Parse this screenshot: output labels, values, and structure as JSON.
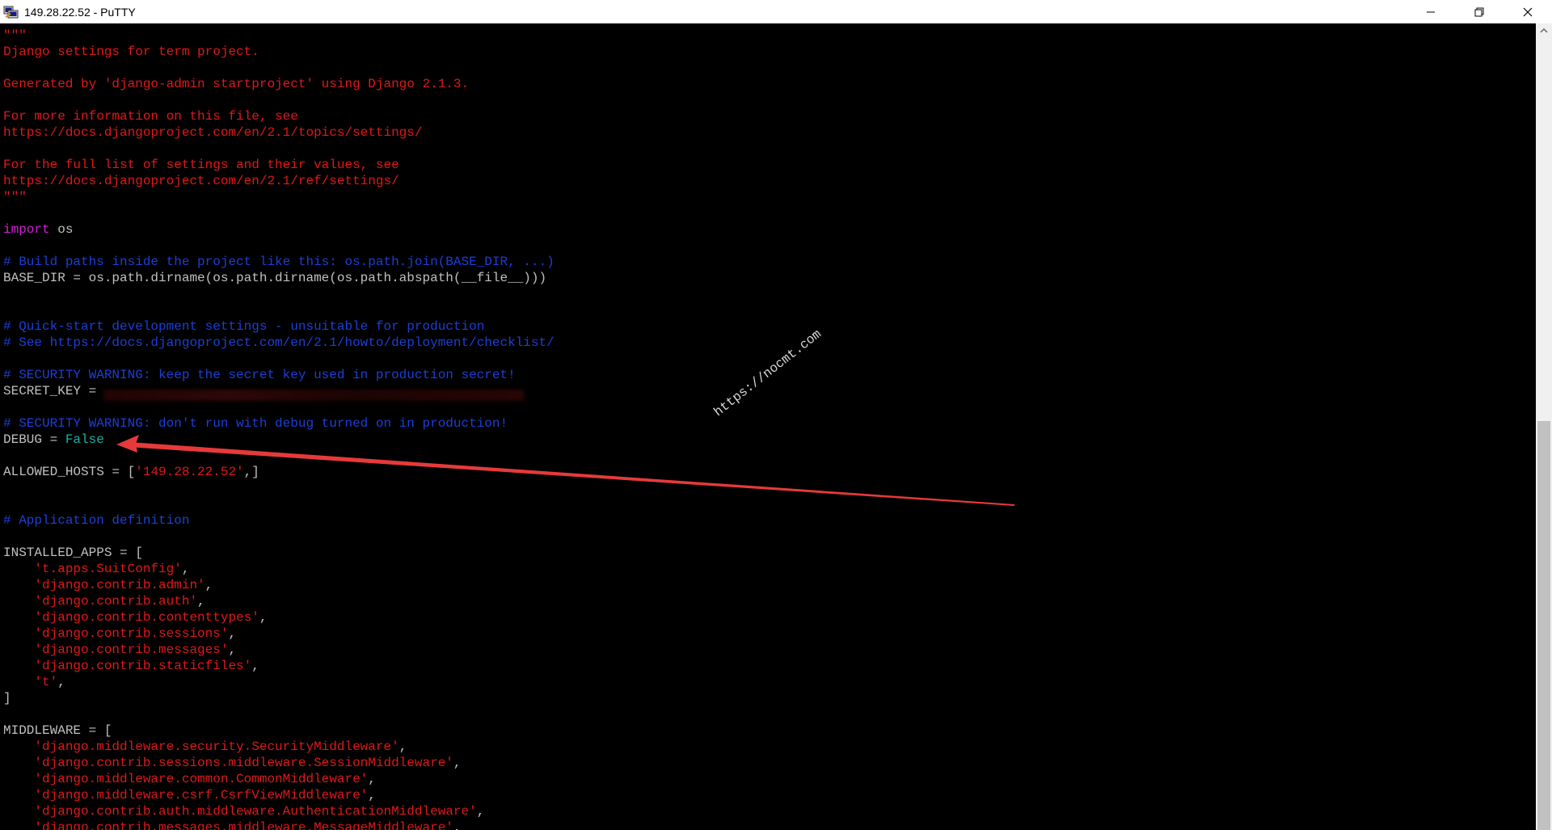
{
  "window": {
    "title": "149.28.22.52 - PuTTY",
    "app_icon": "putty-icon",
    "controls": [
      "minimize-icon",
      "restore-icon",
      "close-icon"
    ]
  },
  "terminal": {
    "lines": [
      {
        "segments": [
          {
            "text": "\"\"\"",
            "color": "red"
          }
        ]
      },
      {
        "segments": [
          {
            "text": "Django settings for term project.",
            "color": "red"
          }
        ]
      },
      {
        "segments": [
          {
            "text": "",
            "color": "gray"
          }
        ]
      },
      {
        "segments": [
          {
            "text": "Generated by 'django-admin startproject' using Django 2.1.3.",
            "color": "red"
          }
        ]
      },
      {
        "segments": [
          {
            "text": "",
            "color": "gray"
          }
        ]
      },
      {
        "segments": [
          {
            "text": "For more information on this file, see",
            "color": "red"
          }
        ]
      },
      {
        "segments": [
          {
            "text": "https://docs.djangoproject.com/en/2.1/topics/settings/",
            "color": "red"
          }
        ]
      },
      {
        "segments": [
          {
            "text": "",
            "color": "gray"
          }
        ]
      },
      {
        "segments": [
          {
            "text": "For the full list of settings and their values, see",
            "color": "red"
          }
        ]
      },
      {
        "segments": [
          {
            "text": "https://docs.djangoproject.com/en/2.1/ref/settings/",
            "color": "red"
          }
        ]
      },
      {
        "segments": [
          {
            "text": "\"\"\"",
            "color": "red"
          }
        ]
      },
      {
        "segments": [
          {
            "text": "",
            "color": "gray"
          }
        ]
      },
      {
        "segments": [
          {
            "text": "import",
            "color": "magenta"
          },
          {
            "text": " os",
            "color": "gray"
          }
        ]
      },
      {
        "segments": [
          {
            "text": "",
            "color": "gray"
          }
        ]
      },
      {
        "segments": [
          {
            "text": "# Build paths inside the project like this: os.path.join(BASE_DIR, ...)",
            "color": "blue"
          }
        ]
      },
      {
        "segments": [
          {
            "text": "BASE_DIR = os.path.dirname(os.path.dirname(os.path.abspath(__file__)))",
            "color": "gray"
          }
        ]
      },
      {
        "segments": [
          {
            "text": "",
            "color": "gray"
          }
        ]
      },
      {
        "segments": [
          {
            "text": "",
            "color": "gray"
          }
        ]
      },
      {
        "segments": [
          {
            "text": "# Quick-start development settings - unsuitable for production",
            "color": "blue"
          }
        ]
      },
      {
        "segments": [
          {
            "text": "# See https://docs.djangoproject.com/en/2.1/howto/deployment/checklist/",
            "color": "blue"
          }
        ]
      },
      {
        "segments": [
          {
            "text": "",
            "color": "gray"
          }
        ]
      },
      {
        "segments": [
          {
            "text": "# SECURITY WARNING: keep the secret key used in production secret!",
            "color": "blue"
          }
        ]
      },
      {
        "segments": [
          {
            "text": "SECRET_KEY = ",
            "color": "gray"
          }
        ]
      },
      {
        "segments": [
          {
            "text": "",
            "color": "gray"
          }
        ]
      },
      {
        "segments": [
          {
            "text": "# SECURITY WARNING: don't run with debug turned on in production!",
            "color": "blue"
          }
        ]
      },
      {
        "segments": [
          {
            "text": "DEBUG = ",
            "color": "gray"
          },
          {
            "text": "False",
            "color": "cyan"
          }
        ]
      },
      {
        "segments": [
          {
            "text": "",
            "color": "gray"
          }
        ]
      },
      {
        "segments": [
          {
            "text": "ALLOWED_HOSTS = [",
            "color": "gray"
          },
          {
            "text": "'149.28.22.52'",
            "color": "red"
          },
          {
            "text": ",]",
            "color": "gray"
          }
        ]
      },
      {
        "segments": [
          {
            "text": "",
            "color": "gray"
          }
        ]
      },
      {
        "segments": [
          {
            "text": "",
            "color": "gray"
          }
        ]
      },
      {
        "segments": [
          {
            "text": "# Application definition",
            "color": "blue"
          }
        ]
      },
      {
        "segments": [
          {
            "text": "",
            "color": "gray"
          }
        ]
      },
      {
        "segments": [
          {
            "text": "INSTALLED_APPS = [",
            "color": "gray"
          }
        ]
      },
      {
        "segments": [
          {
            "text": "    ",
            "color": "gray"
          },
          {
            "text": "'t.apps.SuitConfig'",
            "color": "red"
          },
          {
            "text": ",",
            "color": "gray"
          }
        ]
      },
      {
        "segments": [
          {
            "text": "    ",
            "color": "gray"
          },
          {
            "text": "'django.contrib.admin'",
            "color": "red"
          },
          {
            "text": ",",
            "color": "gray"
          }
        ]
      },
      {
        "segments": [
          {
            "text": "    ",
            "color": "gray"
          },
          {
            "text": "'django.contrib.auth'",
            "color": "red"
          },
          {
            "text": ",",
            "color": "gray"
          }
        ]
      },
      {
        "segments": [
          {
            "text": "    ",
            "color": "gray"
          },
          {
            "text": "'django.contrib.contenttypes'",
            "color": "red"
          },
          {
            "text": ",",
            "color": "gray"
          }
        ]
      },
      {
        "segments": [
          {
            "text": "    ",
            "color": "gray"
          },
          {
            "text": "'django.contrib.sessions'",
            "color": "red"
          },
          {
            "text": ",",
            "color": "gray"
          }
        ]
      },
      {
        "segments": [
          {
            "text": "    ",
            "color": "gray"
          },
          {
            "text": "'django.contrib.messages'",
            "color": "red"
          },
          {
            "text": ",",
            "color": "gray"
          }
        ]
      },
      {
        "segments": [
          {
            "text": "    ",
            "color": "gray"
          },
          {
            "text": "'django.contrib.staticfiles'",
            "color": "red"
          },
          {
            "text": ",",
            "color": "gray"
          }
        ]
      },
      {
        "segments": [
          {
            "text": "    ",
            "color": "gray"
          },
          {
            "text": "'t'",
            "color": "red"
          },
          {
            "text": ",",
            "color": "gray"
          }
        ]
      },
      {
        "segments": [
          {
            "text": "]",
            "color": "gray"
          }
        ]
      },
      {
        "segments": [
          {
            "text": "",
            "color": "gray"
          }
        ]
      },
      {
        "segments": [
          {
            "text": "MIDDLEWARE = [",
            "color": "gray"
          }
        ]
      },
      {
        "segments": [
          {
            "text": "    ",
            "color": "gray"
          },
          {
            "text": "'django.middleware.security.SecurityMiddleware'",
            "color": "red"
          },
          {
            "text": ",",
            "color": "gray"
          }
        ]
      },
      {
        "segments": [
          {
            "text": "    ",
            "color": "gray"
          },
          {
            "text": "'django.contrib.sessions.middleware.SessionMiddleware'",
            "color": "red"
          },
          {
            "text": ",",
            "color": "gray"
          }
        ]
      },
      {
        "segments": [
          {
            "text": "    ",
            "color": "gray"
          },
          {
            "text": "'django.middleware.common.CommonMiddleware'",
            "color": "red"
          },
          {
            "text": ",",
            "color": "gray"
          }
        ]
      },
      {
        "segments": [
          {
            "text": "    ",
            "color": "gray"
          },
          {
            "text": "'django.middleware.csrf.CsrfViewMiddleware'",
            "color": "red"
          },
          {
            "text": ",",
            "color": "gray"
          }
        ]
      },
      {
        "segments": [
          {
            "text": "    ",
            "color": "gray"
          },
          {
            "text": "'django.contrib.auth.middleware.AuthenticationMiddleware'",
            "color": "red"
          },
          {
            "text": ",",
            "color": "gray"
          }
        ]
      },
      {
        "segments": [
          {
            "text": "    ",
            "color": "gray"
          },
          {
            "text": "'django.contrib.messages.middleware.MessageMiddleware'",
            "color": "red"
          },
          {
            "text": ",",
            "color": "gray"
          }
        ]
      }
    ]
  },
  "watermark": "https://nocmt.com",
  "annotation": {
    "type": "arrow",
    "color": "#e63a3a"
  }
}
